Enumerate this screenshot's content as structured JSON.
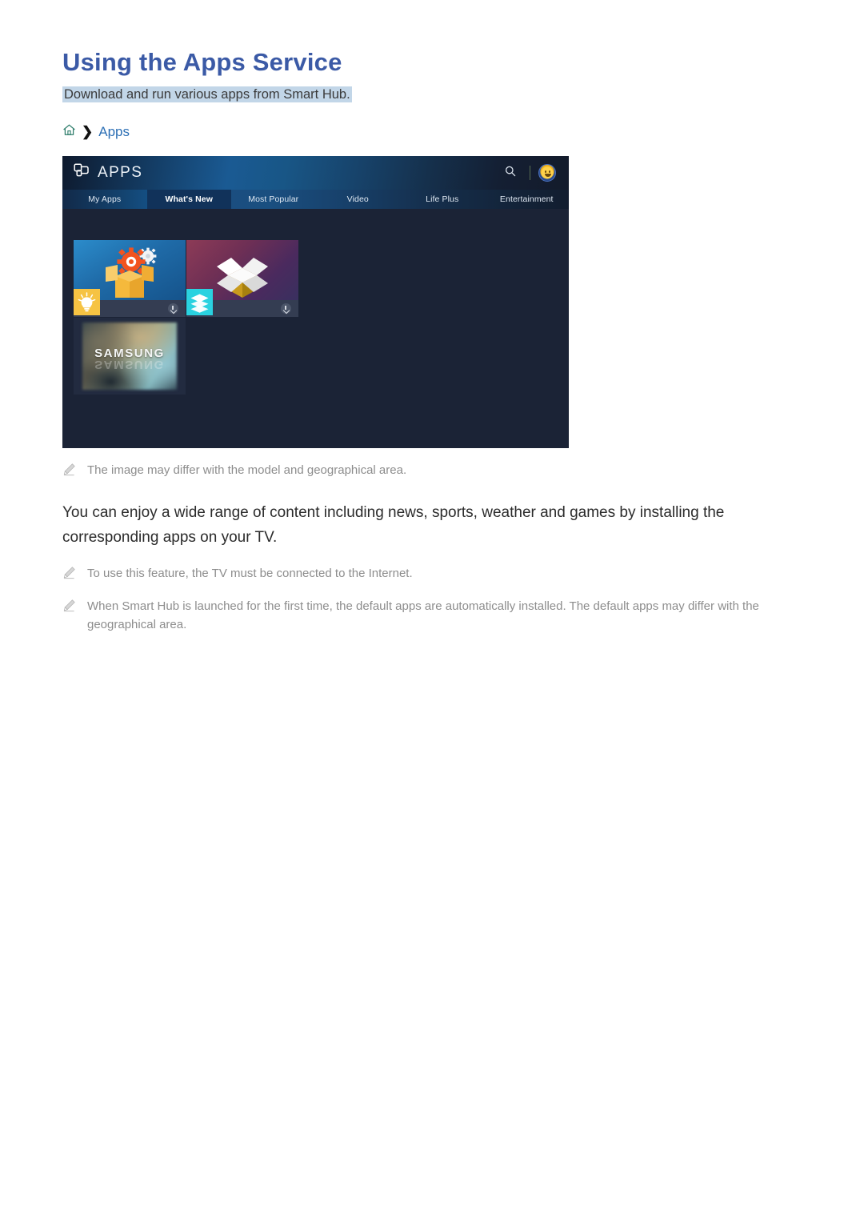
{
  "page": {
    "title": "Using the Apps Service",
    "subtitle": "Download and run various apps from Smart Hub.",
    "body_paragraph": "You can enjoy a wide range of content including news, sports, weather and games by installing the corresponding apps on your TV.",
    "title_color": "#3b5aa6",
    "subtitle_highlight_color": "#c2d6e8"
  },
  "breadcrumb": {
    "home_icon": "home-icon",
    "separator": "›",
    "label": "Apps",
    "link_color": "#2c6fb5",
    "home_icon_color": "#2e7d6b"
  },
  "tv_mockup": {
    "header": {
      "logo_icon": "apps-logo-icon",
      "logo_text": "APPS",
      "search_icon": "search-icon",
      "avatar_icon": "user-avatar-icon"
    },
    "tabs": [
      {
        "label": "My Apps",
        "selected": false
      },
      {
        "label": "What's New",
        "selected": true
      },
      {
        "label": "Most Popular",
        "selected": false
      },
      {
        "label": "Video",
        "selected": false
      },
      {
        "label": "Life Plus",
        "selected": false
      },
      {
        "label": "Entertainment",
        "selected": false
      }
    ],
    "tiles": [
      {
        "name": "app-tile-gear-box",
        "badge_icon": "lightbulb-icon",
        "download_icon": "download-icon"
      },
      {
        "name": "app-tile-open-box",
        "badge_icon": "layers-icon",
        "download_icon": "download-icon"
      },
      {
        "name": "app-tile-samsung",
        "brand_text": "SAMSUNG"
      }
    ],
    "background_color": "#1b2336"
  },
  "notes": {
    "image_note": "The image may differ with the model and geographical area.",
    "lower": [
      "To use this feature, the TV must be connected to the Internet.",
      "When Smart Hub is launched for the first time, the default apps are automatically installed. The default apps may differ with the geographical area."
    ],
    "icon": "pencil-icon",
    "text_color": "#8d8d8d"
  }
}
